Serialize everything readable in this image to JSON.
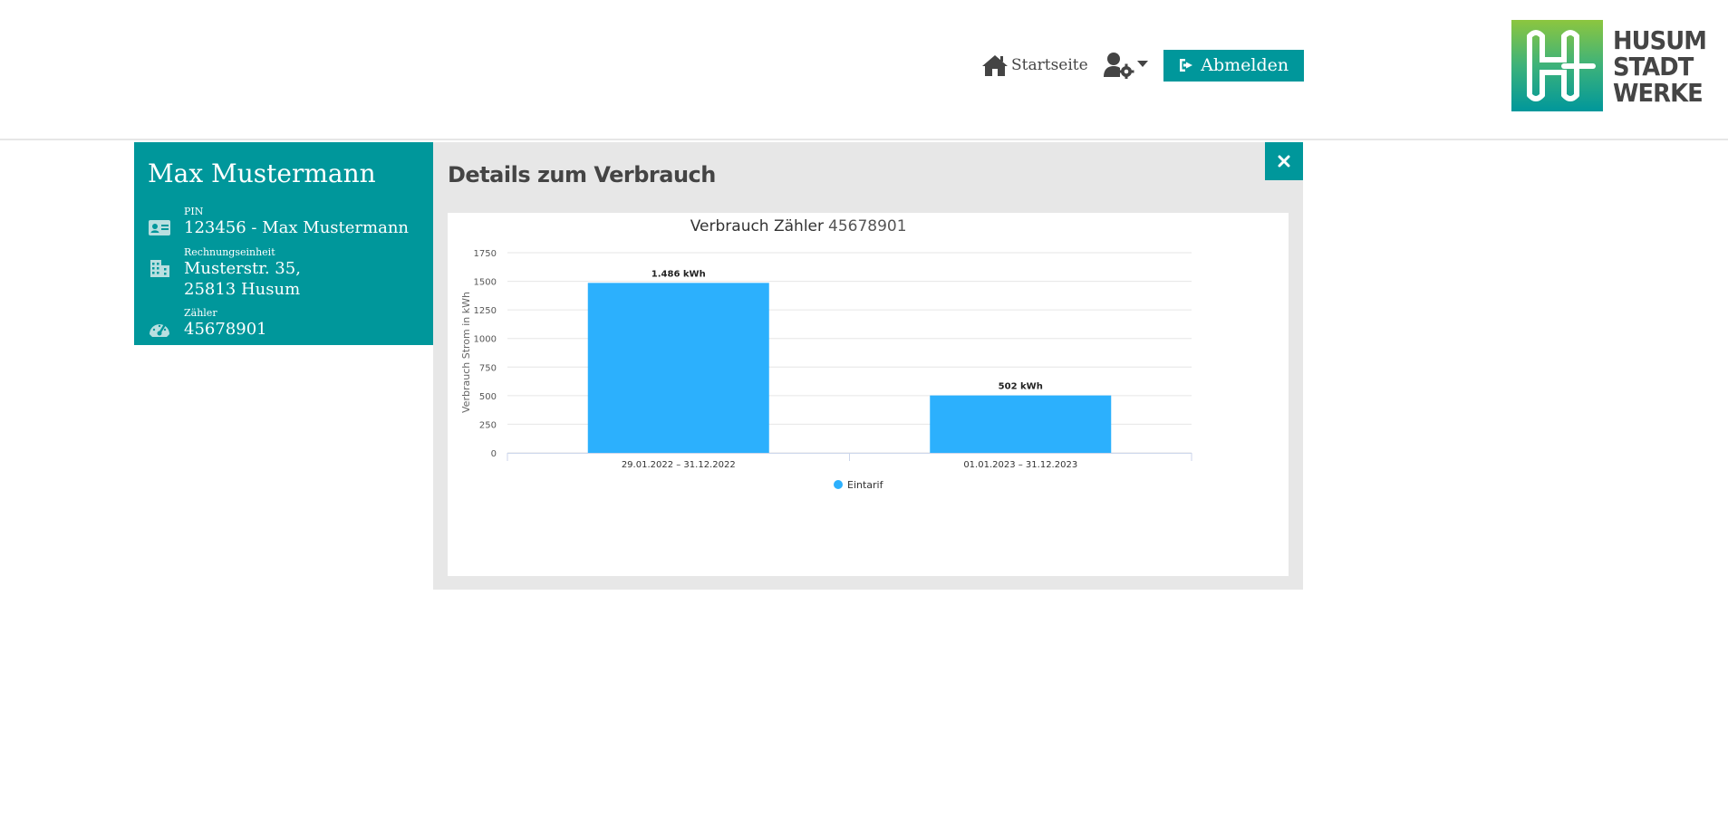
{
  "header": {
    "home_label": "Startseite",
    "logout_label": "Abmelden",
    "logo_lines": [
      "HUSUM",
      "STADT",
      "WERKE"
    ]
  },
  "customer": {
    "name": "Max Mustermann",
    "pin_label": "PIN",
    "pin_value": "123456 - Max Mustermann",
    "unit_label": "Rechnungseinheit",
    "unit_street": "Musterstr. 35,",
    "unit_city": "25813 Husum",
    "meter_label": "Zähler",
    "meter_value": "45678901"
  },
  "details": {
    "title": "Details zum Verbrauch"
  },
  "colors": {
    "accent": "#00979b",
    "bar": "#2cb0fd"
  },
  "chart_data": {
    "type": "bar",
    "title": "Verbrauch Zähler",
    "subtitle": "45678901",
    "ylabel": "Verbrauch Strom in kWh",
    "xlabel": "",
    "ylim": [
      0,
      1750
    ],
    "yticks": [
      0,
      250,
      500,
      750,
      1000,
      1250,
      1500,
      1750
    ],
    "categories": [
      "29.01.2022 – 31.12.2022",
      "01.01.2023 – 31.12.2023"
    ],
    "series": [
      {
        "name": "Eintarif",
        "values": [
          1486,
          502
        ],
        "data_labels": [
          "1.486 kWh",
          "502 kWh"
        ]
      }
    ],
    "grid": true,
    "legend": "bottom-center"
  }
}
